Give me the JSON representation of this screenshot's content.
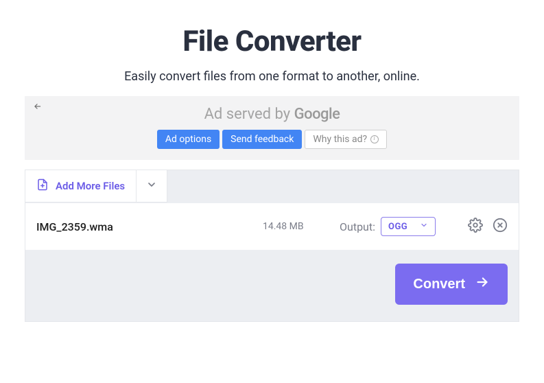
{
  "header": {
    "title": "File Converter",
    "subtitle": "Easily convert files from one format to another, online."
  },
  "ad": {
    "served_prefix": "Ad served by ",
    "served_brand": "Google",
    "options_label": "Ad options",
    "feedback_label": "Send feedback",
    "why_label": "Why this ad?"
  },
  "toolbar": {
    "add_more_label": "Add More Files"
  },
  "file": {
    "name": "IMG_2359.wma",
    "size": "14.48 MB",
    "output_label": "Output:",
    "output_value": "OGG"
  },
  "actions": {
    "convert_label": "Convert"
  }
}
